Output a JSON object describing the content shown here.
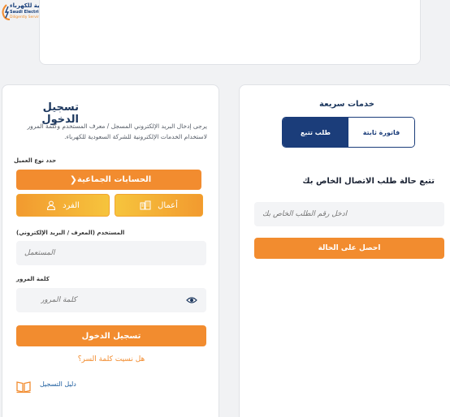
{
  "brand": {
    "name_ar": "الشركة السعودية للكهرباء",
    "name_en": "Saudi Electricity Company",
    "tagline": "Diligently Serving You",
    "accent": "#f28c2f",
    "primary": "#1b3d7a"
  },
  "login": {
    "title": "تسجيل الدخول",
    "description": "يرجى إدخال البريد الإلكتروني المسجل / معرف المستخدم وكلمة المرور لاستخدام الخدمات الإلكترونية للشركة السعودية للكهرباء.",
    "account_type_label": "حدد نوع العميل",
    "group_accounts_button": "الحسابات الجماعية",
    "business_button": "أعمال",
    "individual_button": "الفرد",
    "username_label": "المستخدم (المعرف / البريد الإلكتروني)",
    "username_placeholder": "المستعمل",
    "password_label": "كلمة المرور",
    "password_placeholder": "كلمة المرور",
    "login_button": "تسجيل الدخول",
    "forgot_password": "هل نسيت كلمة السر؟",
    "guide_link": "دليل التسجيل"
  },
  "quick_services": {
    "title": "خدمات سريعة",
    "tabs": [
      "فاتورة ثابتة",
      "طلب تتبع"
    ],
    "active_tab": "طلب تتبع",
    "track_title": "تتبع حالة طلب الاتصال الخاص بك",
    "track_placeholder": "أدخل رقم الطلب الخاص بك",
    "status_button": "احصل على الحالة"
  },
  "icons": [
    "sec-logo-icon",
    "chevron-left-icon",
    "building-icon",
    "user-icon",
    "eye-icon",
    "book-icon"
  ]
}
